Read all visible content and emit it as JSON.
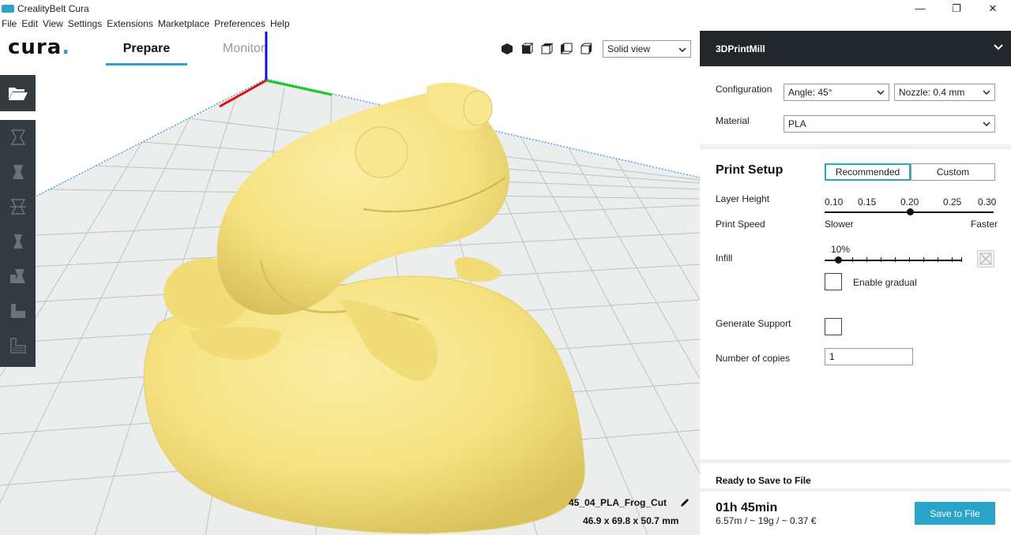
{
  "window": {
    "title": "CrealityBelt Cura",
    "minimize_glyph": "—",
    "restore_glyph": "❐",
    "close_glyph": "✕"
  },
  "menu": [
    "File",
    "Edit",
    "View",
    "Settings",
    "Extensions",
    "Marketplace",
    "Preferences",
    "Help"
  ],
  "header": {
    "logo_text": "cura",
    "logo_dot": ".",
    "tabs": [
      {
        "label": "Prepare",
        "active": true
      },
      {
        "label": "Monitor",
        "active": false
      }
    ],
    "view_mode": "Solid view"
  },
  "model": {
    "name": "45_04_PLA_Frog_Cut",
    "dimensions": "46.9 x 69.8 x 50.7 mm",
    "color": "#f5e17f"
  },
  "panel": {
    "printer_name": "3DPrintMill",
    "configuration_label": "Configuration",
    "angle_value": "Angle: 45°",
    "nozzle_value": "Nozzle: 0.4 mm",
    "material_label": "Material",
    "material_value": "PLA",
    "print_setup_title": "Print Setup",
    "mode_recommended": "Recommended",
    "mode_custom": "Custom",
    "layer_height_label": "Layer Height",
    "layer_heights": [
      "0.10",
      "0.15",
      "0.20",
      "0.25",
      "0.30"
    ],
    "layer_height_selected": "0.20",
    "print_speed_label": "Print Speed",
    "speed_slower": "Slower",
    "speed_faster": "Faster",
    "infill_label": "Infill",
    "infill_value": "10%",
    "enable_gradual_label": "Enable gradual",
    "generate_support_label": "Generate Support",
    "copies_label": "Number of copies",
    "copies_value": "1"
  },
  "footer": {
    "status": "Ready to Save to File",
    "time": "01h 45min",
    "detail": "6.57m / ~ 19g / ~ 0.37 €",
    "save_label": "Save to File"
  },
  "colors": {
    "accent": "#2aa3c7",
    "toolbar": "#333a40",
    "printer_bar": "#22272c",
    "axis_x": "#e01010",
    "axis_y": "#1fc81f",
    "axis_z": "#1010e0"
  }
}
